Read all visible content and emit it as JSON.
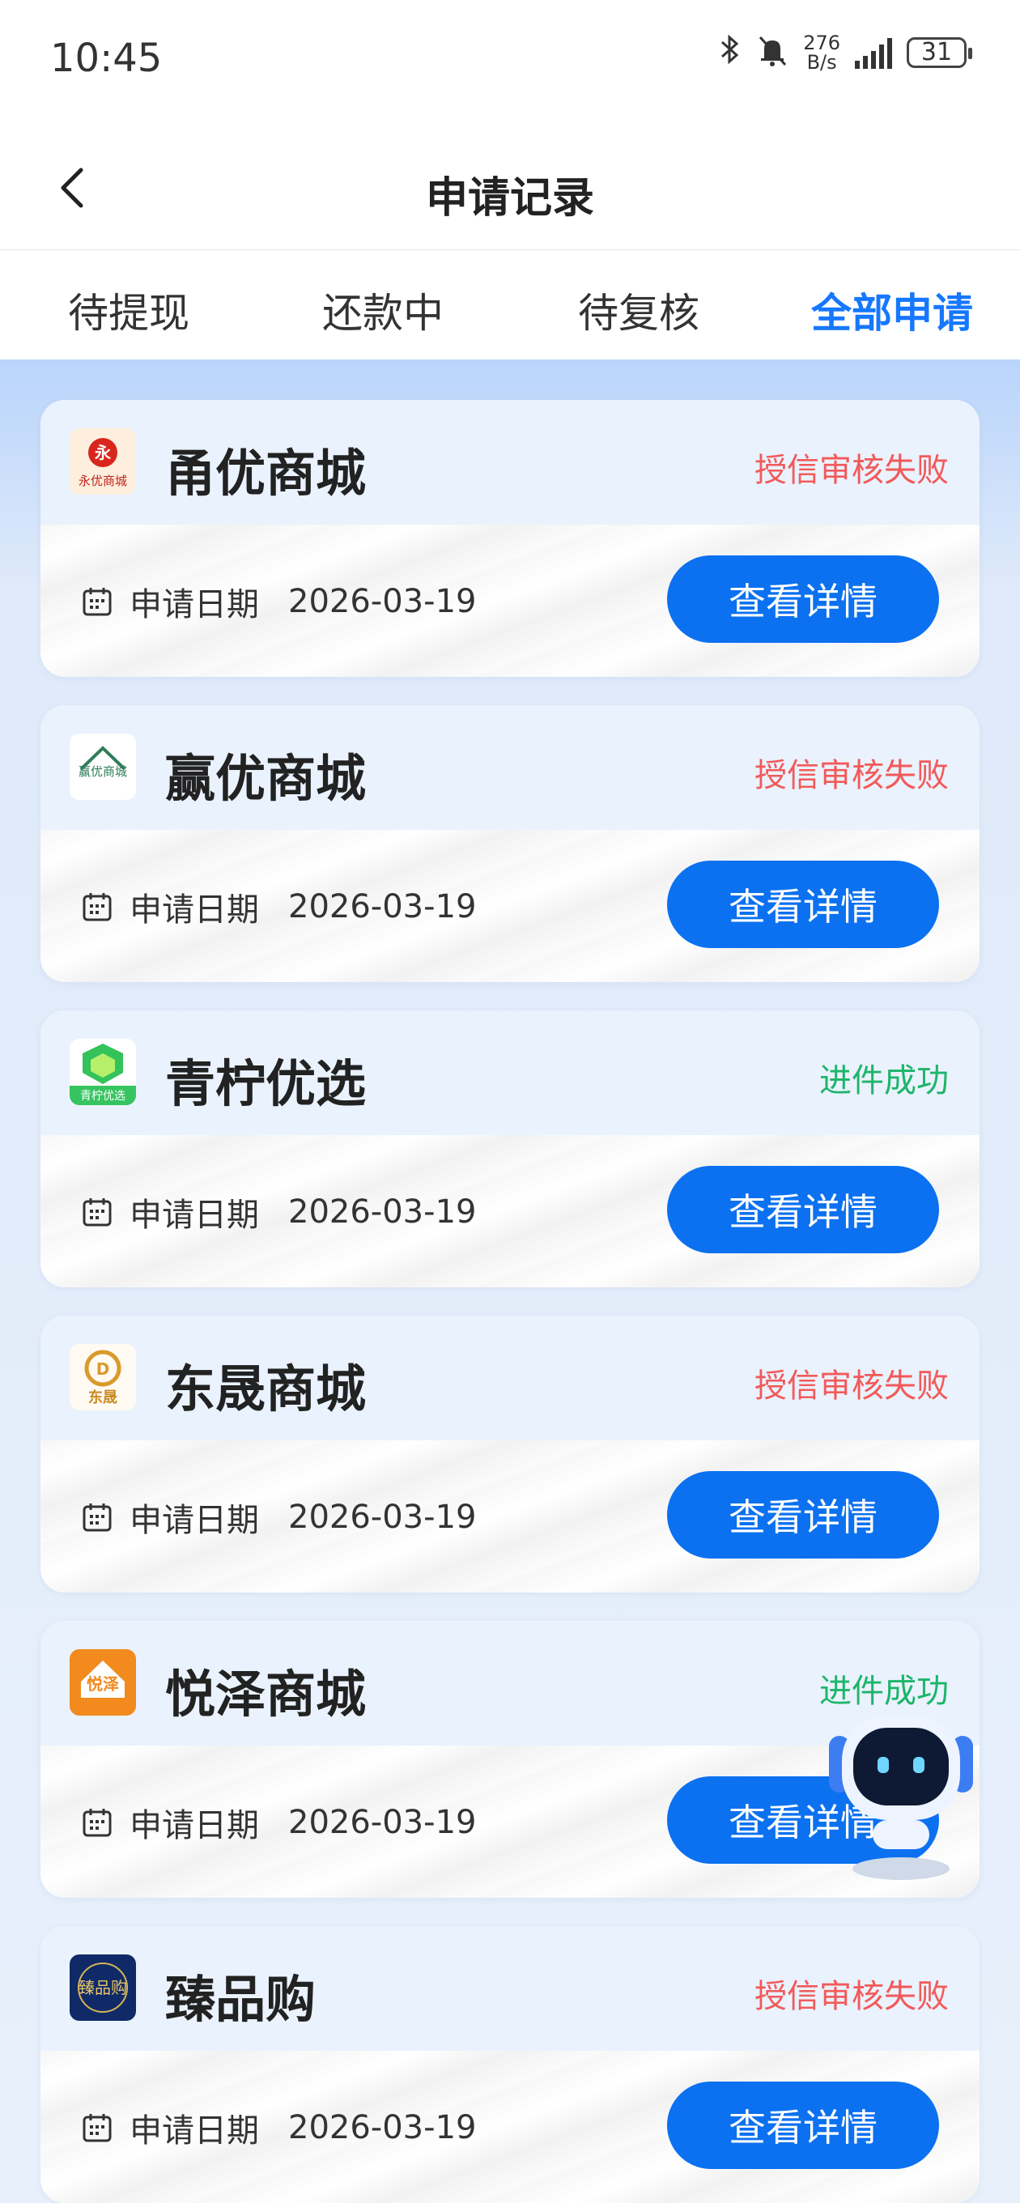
{
  "status_bar": {
    "time": "10:45",
    "net_speed_value": "276",
    "net_speed_unit": "B/s",
    "battery": "31"
  },
  "header": {
    "title": "申请记录"
  },
  "tabs": [
    {
      "label": "待提现",
      "active": false
    },
    {
      "label": "还款中",
      "active": false
    },
    {
      "label": "待复核",
      "active": false
    },
    {
      "label": "全部申请",
      "active": true
    }
  ],
  "records": [
    {
      "name": "甬优商城",
      "logo_text": "永优商城",
      "status": "授信审核失败",
      "status_type": "fail",
      "date_label": "申请日期",
      "date": "2026-03-19",
      "button": "查看详情"
    },
    {
      "name": "赢优商城",
      "logo_text": "赢优商城",
      "status": "授信审核失败",
      "status_type": "fail",
      "date_label": "申请日期",
      "date": "2026-03-19",
      "button": "查看详情"
    },
    {
      "name": "青柠优选",
      "logo_text": "青柠优选",
      "status": "进件成功",
      "status_type": "success",
      "date_label": "申请日期",
      "date": "2026-03-19",
      "button": "查看详情"
    },
    {
      "name": "东晟商城",
      "logo_text": "东晟",
      "status": "授信审核失败",
      "status_type": "fail",
      "date_label": "申请日期",
      "date": "2026-03-19",
      "button": "查看详情"
    },
    {
      "name": "悦泽商城",
      "logo_text": "悦泽",
      "status": "进件成功",
      "status_type": "success",
      "date_label": "申请日期",
      "date": "2026-03-19",
      "button": "查看详情"
    },
    {
      "name": "臻品购",
      "logo_text": "臻品购",
      "status": "授信审核失败",
      "status_type": "fail",
      "date_label": "申请日期",
      "date": "2026-03-19",
      "button": "查看详情"
    }
  ],
  "colors": {
    "accent": "#1677ff",
    "button": "#0b71f0",
    "fail": "#f25a5a",
    "success": "#1db56a"
  },
  "icons": {
    "back": "chevron-left-icon",
    "calendar": "calendar-icon",
    "assistant": "robot-assistant-icon"
  }
}
